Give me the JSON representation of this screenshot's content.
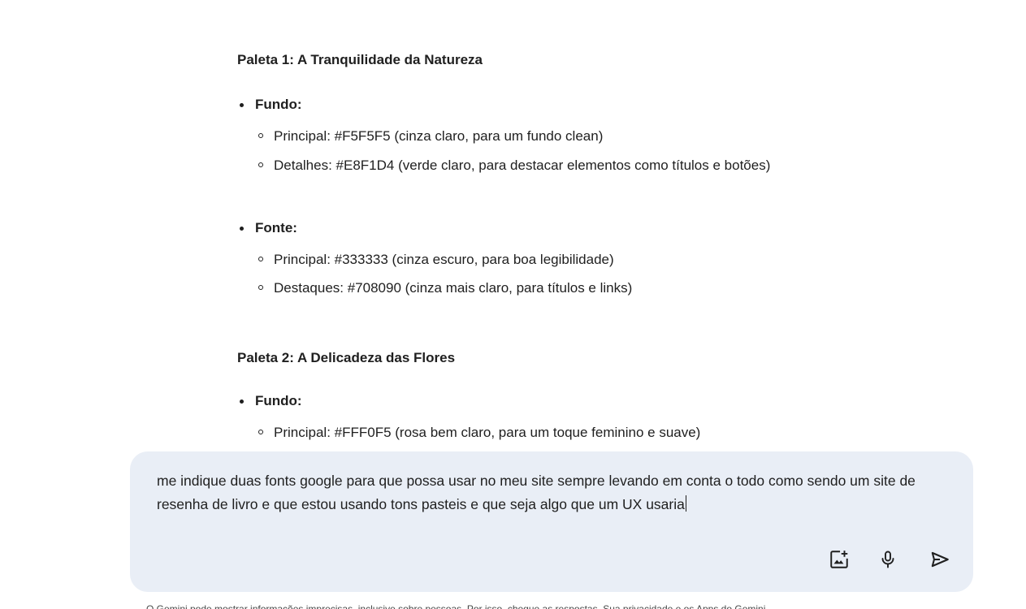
{
  "palette1": {
    "title": "Paleta 1: A Tranquilidade da Natureza",
    "fundo_label": "Fundo:",
    "fundo_items": [
      "Principal: #F5F5F5 (cinza claro, para um fundo clean)",
      "Detalhes: #E8F1D4 (verde claro, para destacar elementos como títulos e botões)"
    ],
    "fonte_label": "Fonte:",
    "fonte_items": [
      "Principal: #333333 (cinza escuro, para boa legibilidade)",
      "Destaques: #708090 (cinza mais claro, para títulos e links)"
    ]
  },
  "palette2": {
    "title": "Paleta 2: A Delicadeza das Flores",
    "fundo_label": "Fundo:",
    "fundo_items": [
      "Principal: #FFF0F5 (rosa bem claro, para um toque feminino e suave)"
    ]
  },
  "prompt": {
    "text": "me indique duas fonts google para que possa usar no meu site sempre levando em conta o todo como sendo um site de resenha de livro e que estou usando tons pasteis e que seja algo que um UX usaria"
  },
  "icons": {
    "image": "add-image-icon",
    "mic": "microphone-icon",
    "send": "send-icon"
  },
  "footer": {
    "text": "O Gemini pode mostrar informações imprecisas, inclusive sobre pessoas. Por isso, cheque as respostas. Sua privacidade e os Apps do Gemini"
  }
}
